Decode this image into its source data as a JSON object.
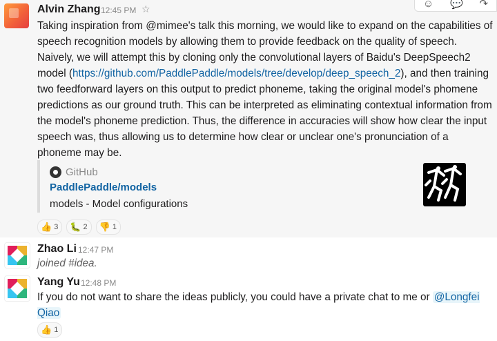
{
  "messages": [
    {
      "author": "Alvin Zhang",
      "time": "12:45 PM",
      "text_part1": "Taking inspiration from @mimee's talk this morning, we would like to expand on the capabilities of speech recognition models by allowing them to provide feedback on the quality of speech. Naively, we will attempt this by cloning only the convolutional layers of Baidu's DeepSpeech2 model (",
      "link": "https://github.com/PaddlePaddle/models/tree/develop/deep_speech_2",
      "text_part2": "), and then training two feedforward layers on this output to predict phoneme, taking the original model's phomene predictions as our ground truth. This can be interpreted as eliminating contextual information from the model's phoneme prediction. Thus, the difference in accuracies will show how clear the input speech was, thus allowing us to determine how clear or unclear one's pronunciation of a phoneme may be.",
      "attachment": {
        "service": "GitHub",
        "title": "PaddlePaddle/models",
        "description": "models - Model configurations"
      },
      "reactions": [
        {
          "emoji": "👍",
          "count": "3"
        },
        {
          "emoji": "🐛",
          "count": "2"
        },
        {
          "emoji": "👎",
          "count": "1"
        }
      ]
    },
    {
      "author": "Zhao Li",
      "time": "12:47 PM",
      "text": "joined #idea."
    },
    {
      "author": "Yang Yu",
      "time": "12:48 PM",
      "text": "If you do not want to share the ideas publicly, you could have a private chat to me or ",
      "mention": "@Longfei Qiao",
      "reactions": [
        {
          "emoji": "👍",
          "count": "1"
        }
      ]
    }
  ],
  "hover_actions": {
    "icons": [
      "add-reaction-icon",
      "reply-thread-icon",
      "share-icon"
    ]
  },
  "colors": {
    "link": "#1264a3",
    "highlight": "#f6f6f6"
  }
}
